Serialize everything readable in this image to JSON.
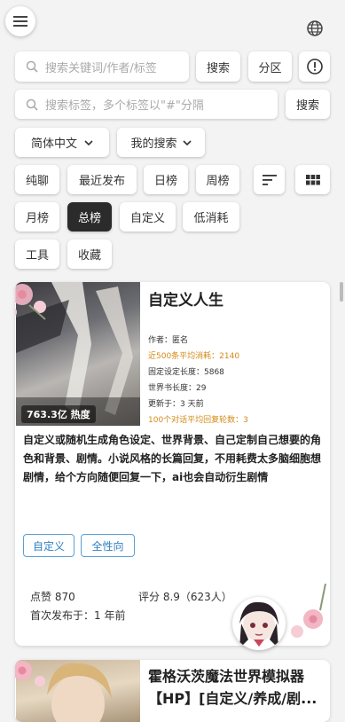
{
  "search": {
    "placeholder": "搜索关键词/作者/标签",
    "search_label": "搜索",
    "region_label": "分区"
  },
  "tag_search": {
    "placeholder": "搜索标签，多个标签以\"#\"分隔",
    "search_label": "搜索"
  },
  "dropdowns": {
    "language": "简体中文",
    "my_search": "我的搜索"
  },
  "filters": {
    "chat": "纯聊",
    "recent": "最近发布",
    "daily": "日榜",
    "weekly": "周榜",
    "monthly": "月榜",
    "total": "总榜",
    "custom": "自定义",
    "low_cost": "低消耗",
    "tools": "工具",
    "favorites": "收藏"
  },
  "card1": {
    "title": "自定义人生",
    "heat": "763.3亿 热度",
    "author": "作者：匿名",
    "avg_cost": "近500条平均消耗：2140",
    "fixed_len": "固定设定长度：5868",
    "world_len": "世界书长度：29",
    "updated": "更新于：3 天前",
    "avg_rounds": "100个对话平均回复轮数：3",
    "description": "自定义或随机生成角色设定、世界背景、自己定制自己想要的角色和背景、剧情。小说风格的长篇回复，不用耗费太多脑细胞想剧情，给个方向随便回复一下，ai也会自动衍生剧情",
    "tags": [
      "自定义",
      "全性向"
    ],
    "likes": "点赞 870",
    "rating": "评分 8.9（623人）",
    "first_published": "首次发布于：1 年前"
  },
  "card2": {
    "title": "霍格沃茨魔法世界模拟器【HP】[自定义/养成/剧..."
  },
  "colors": {
    "accent_orange": "#d48a16",
    "tag_blue": "#2f7fc0",
    "dark_button": "#2b2b2b"
  }
}
